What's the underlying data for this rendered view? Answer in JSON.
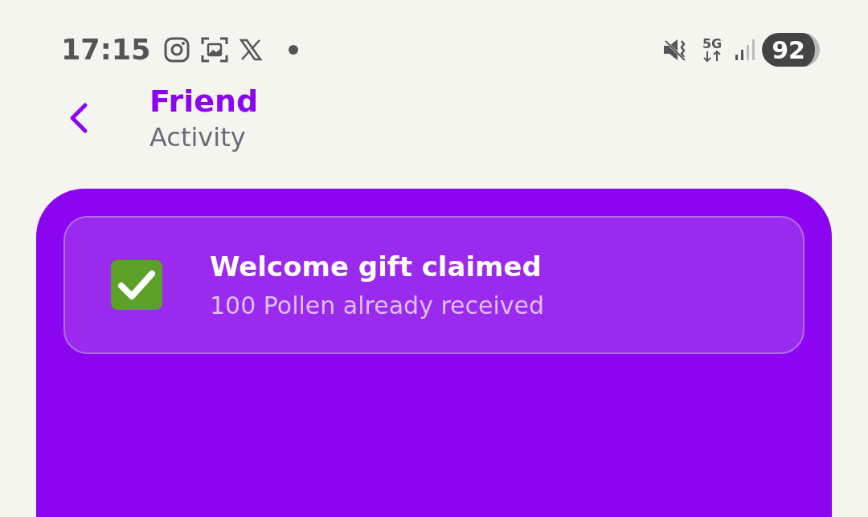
{
  "status_bar": {
    "time": "17:15",
    "network": "5G",
    "battery": "92"
  },
  "header": {
    "title": "Friend",
    "subtitle": "Activity"
  },
  "notice": {
    "title": "Welcome gift claimed",
    "detail": "100 Pollen already received"
  }
}
